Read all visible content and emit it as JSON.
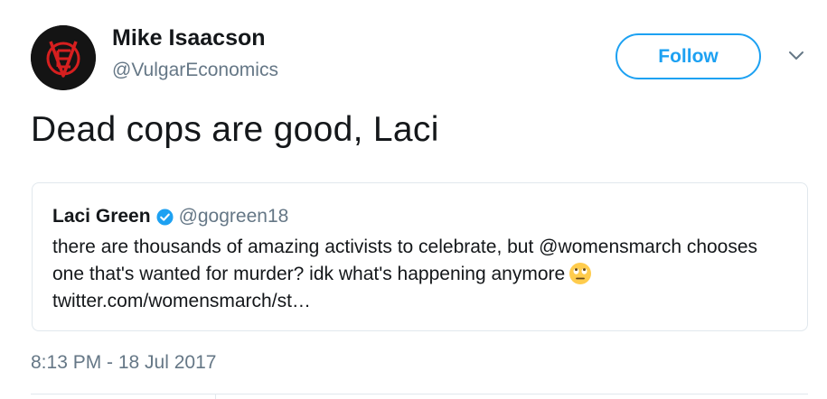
{
  "author": {
    "display_name": "Mike Isaacson",
    "handle": "@VulgarEconomics",
    "avatar_icon": "ve-logo-icon"
  },
  "actions": {
    "follow_label": "Follow",
    "more_icon": "chevron-down-icon"
  },
  "tweet": {
    "text": "Dead cops are good, Laci",
    "timestamp": "8:13 PM - 18 Jul 2017"
  },
  "quoted_tweet": {
    "display_name": "Laci Green",
    "verified_icon": "verified-badge-icon",
    "handle": "@gogreen18",
    "line1": "there are thousands of amazing activists to celebrate, but @womensmarch chooses",
    "line2": "one that's wanted for murder? idk what's happening anymore",
    "emoji_icon": "eye-roll-emoji-icon",
    "link": "twitter.com/womensmarch/st…"
  },
  "colors": {
    "accent": "#1da1f2",
    "secondary_text": "#657786",
    "primary_text": "#14171a",
    "border": "#e1e8ed"
  }
}
